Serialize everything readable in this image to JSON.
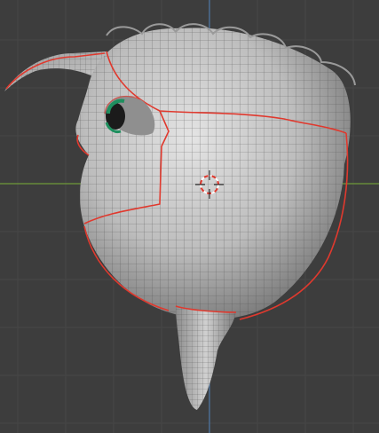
{
  "viewport": {
    "view": "3d-viewport",
    "mode": "edit-mesh",
    "object": "mesh-creature",
    "cursor_icon": "3d-cursor-icon",
    "colors": {
      "background": "#3d3d3d",
      "grid_line": "#474747",
      "axis_x": "#6f9a3a",
      "axis_z": "#4f79a8",
      "mesh_base": "#b7b7b7",
      "mesh_light": "#e6e6e6",
      "mesh_shadow": "#6e6e6e",
      "wire": "#4a4a4a",
      "seam": "#e0392e",
      "eye_green": "#1f8f5f",
      "eye_dark": "#1b1b1b"
    }
  }
}
